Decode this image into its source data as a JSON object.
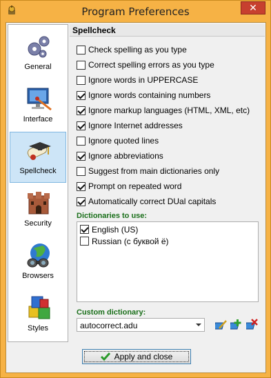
{
  "window": {
    "title": "Program Preferences",
    "close_label": "✕",
    "colors": {
      "frame": "#f6b245",
      "selection": "#cde5f7",
      "section_green": "#1a6f1a"
    }
  },
  "nav": {
    "items": [
      {
        "label": "General",
        "icon": "gears-icon"
      },
      {
        "label": "Interface",
        "icon": "paint-monitor-icon"
      },
      {
        "label": "Spellcheck",
        "icon": "diploma-icon",
        "active": true
      },
      {
        "label": "Security",
        "icon": "castle-icon"
      },
      {
        "label": "Browsers",
        "icon": "globe-binoculars-icon"
      },
      {
        "label": "Styles",
        "icon": "cubes-icon"
      }
    ]
  },
  "panel": {
    "header": "Spellcheck",
    "options": [
      {
        "label": "Check spelling as you type",
        "checked": false
      },
      {
        "label": "Correct spelling errors as you type",
        "checked": false
      },
      {
        "label": "Ignore words in UPPERCASE",
        "checked": false
      },
      {
        "label": "Ignore words containing numbers",
        "checked": true
      },
      {
        "label": "Ignore markup languages (HTML, XML, etc)",
        "checked": true
      },
      {
        "label": "Ignore Internet addresses",
        "checked": true
      },
      {
        "label": "Ignore quoted lines",
        "checked": false
      },
      {
        "label": "Ignore abbreviations",
        "checked": true
      },
      {
        "label": "Suggest from main dictionaries only",
        "checked": false
      },
      {
        "label": "Prompt on repeated word",
        "checked": true
      },
      {
        "label": "Automatically correct DUal capitals",
        "checked": true
      }
    ],
    "dictionaries_label": "Dictionaries to use:",
    "dictionaries": [
      {
        "label": "English (US)",
        "checked": true
      },
      {
        "label": "Russian (с буквой ё)",
        "checked": false
      }
    ],
    "custom_dictionary_label": "Custom dictionary:",
    "custom_dictionary_value": "autocorrect.adu",
    "tools": [
      "edit-dictionary-icon",
      "add-dictionary-icon",
      "delete-dictionary-icon"
    ]
  },
  "footer": {
    "apply_label": "Apply and close"
  }
}
